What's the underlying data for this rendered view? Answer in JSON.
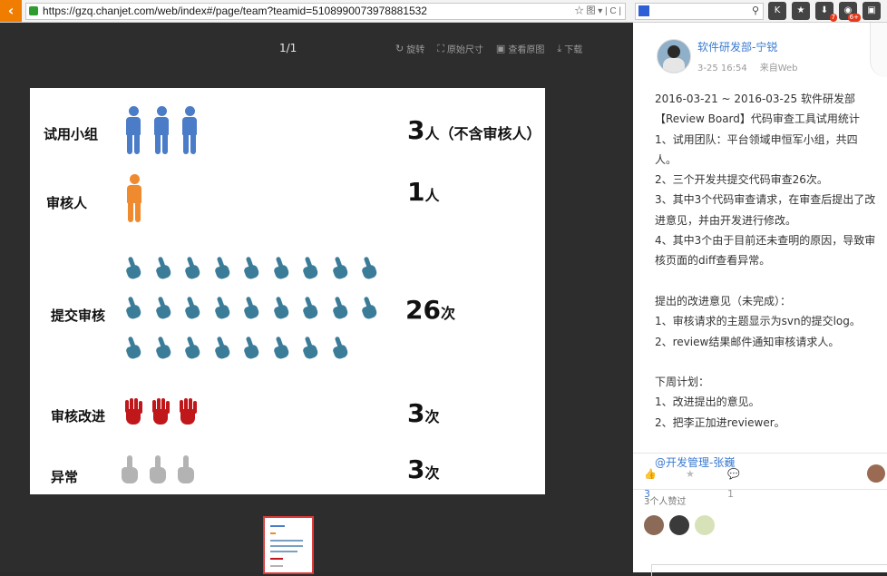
{
  "browser": {
    "url": "https://gzq.chanjet.com/web/index#/page/team?teamid=5108990073978881532",
    "addr_tools": "☆ 图 ▾ | C |",
    "ext_badges": [
      "7",
      "6+"
    ]
  },
  "viewer": {
    "page_indicator": "1/1",
    "tools": [
      {
        "icon": "rotate-icon",
        "label": "旋转"
      },
      {
        "icon": "fullsize-icon",
        "label": "原始尺寸"
      },
      {
        "icon": "image-icon",
        "label": "查看原图"
      },
      {
        "icon": "download-icon",
        "label": "下载"
      }
    ]
  },
  "slide": {
    "rows": [
      {
        "label": "试用小组",
        "num": "3",
        "unit": "人（不含审核人）",
        "icon_color": "#4a7cc7",
        "count": 3
      },
      {
        "label": "审核人",
        "num": "1",
        "unit": "人",
        "icon_color": "#f08a2e",
        "count": 1
      },
      {
        "label": "提交审核",
        "num": "26",
        "unit": "次",
        "icon_color": "#3b7d99",
        "count": 26
      },
      {
        "label": "审核改进",
        "num": "3",
        "unit": "次",
        "icon_color": "#c0171b",
        "count": 3
      },
      {
        "label": "异常",
        "num": "3",
        "unit": "次",
        "icon_color": "#b3b3b3",
        "count": 3
      }
    ]
  },
  "post": {
    "author": "软件研发部-宁锐",
    "time": "3-25 16:54",
    "source": "来自Web",
    "lines": [
      "2016-03-21 ~ 2016-03-25 软件研发部【Review Board】代码审查工具试用统计",
      "1、试用团队：平台领域申恒军小组，共四人。",
      "2、三个开发共提交代码审查26次。",
      "3、其中3个代码审查请求，在审查后提出了改进意见，并由开发进行修改。",
      "4、其中3个由于目前还未查明的原因，导致审核页面的diff查看异常。",
      "",
      "提出的改进意见（未完成）：",
      "1、审核请求的主题显示为svn的提交log。",
      "2、review结果邮件通知审核请求人。",
      "",
      "下周计划：",
      "1、改进提出的意见。",
      "2、把李正加进reviewer。",
      ""
    ],
    "mention": "@开发管理-张巍",
    "likes": "3",
    "comments": "1",
    "likers_label": "3个人赞过"
  }
}
